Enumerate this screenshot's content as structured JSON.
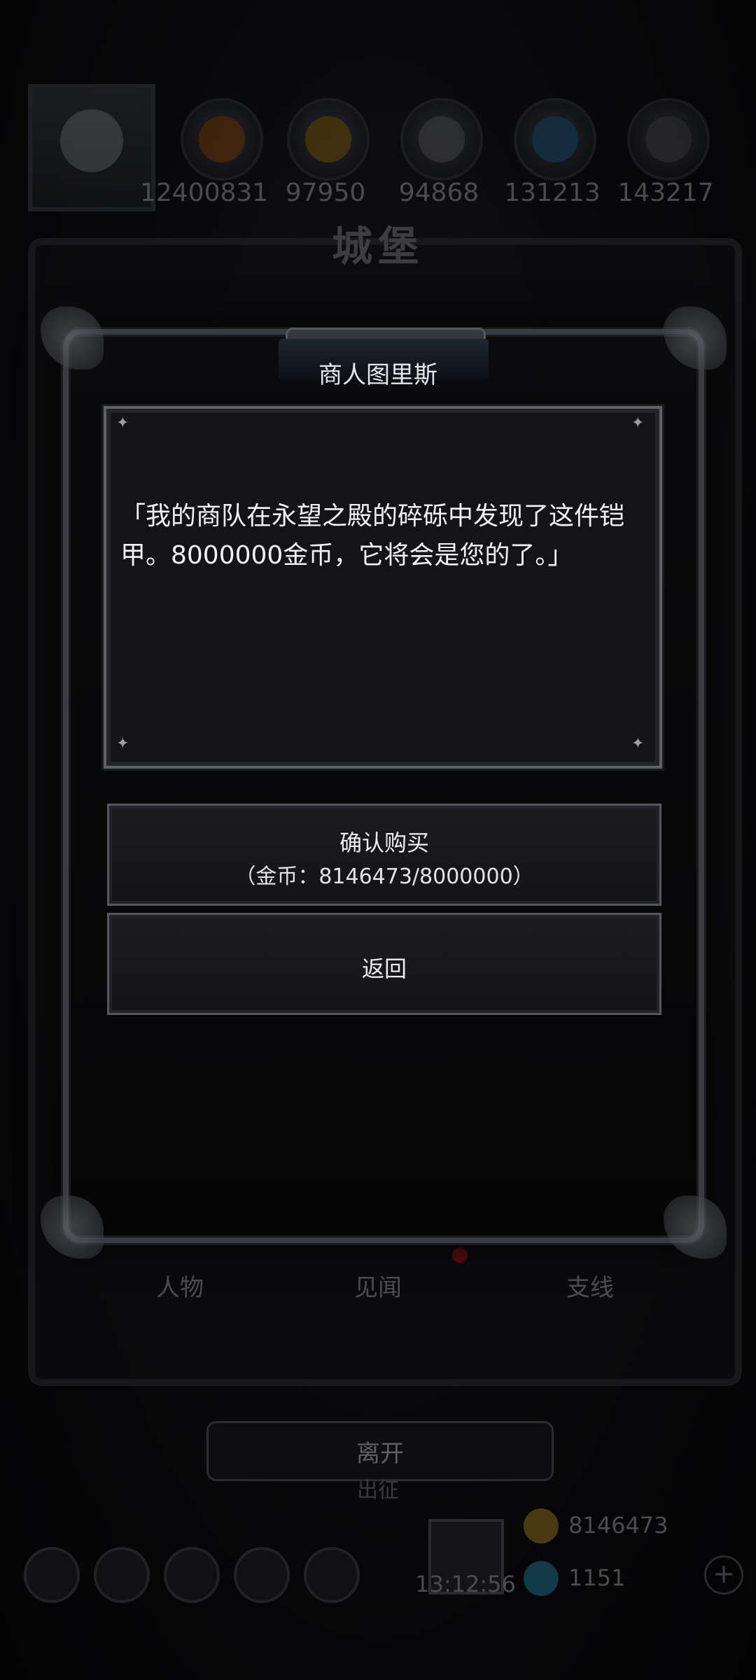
{
  "background": {
    "title": "城堡",
    "resources": [
      "12400831",
      "97950",
      "94868",
      "131213",
      "143217"
    ],
    "tabs": [
      "人物",
      "见闻",
      "支线"
    ],
    "leave_label": "离开",
    "go_label": "出征",
    "timer": "13:12:56",
    "gold": "8146473",
    "gems": "1151",
    "plus": "+"
  },
  "dialog": {
    "title": "商人图里斯",
    "message": "「我的商队在永望之殿的碎砾中发现了这件铠甲。8000000金币，它将会是您的了。」",
    "confirm_label": "确认购买",
    "confirm_detail": "（金币：8146473/8000000）",
    "back_label": "返回",
    "star_glyph": "✦"
  },
  "colors": {
    "accent_text": "#f2f2f4",
    "frame": "#5f6166",
    "background": "#050506"
  },
  "icons": [
    "avatar-icon",
    "bread-icon",
    "wood-icon",
    "iron-icon",
    "crystal-icon",
    "scroll-icon",
    "gift-icon",
    "gold-coin-icon",
    "gem-icon",
    "plus-icon"
  ]
}
